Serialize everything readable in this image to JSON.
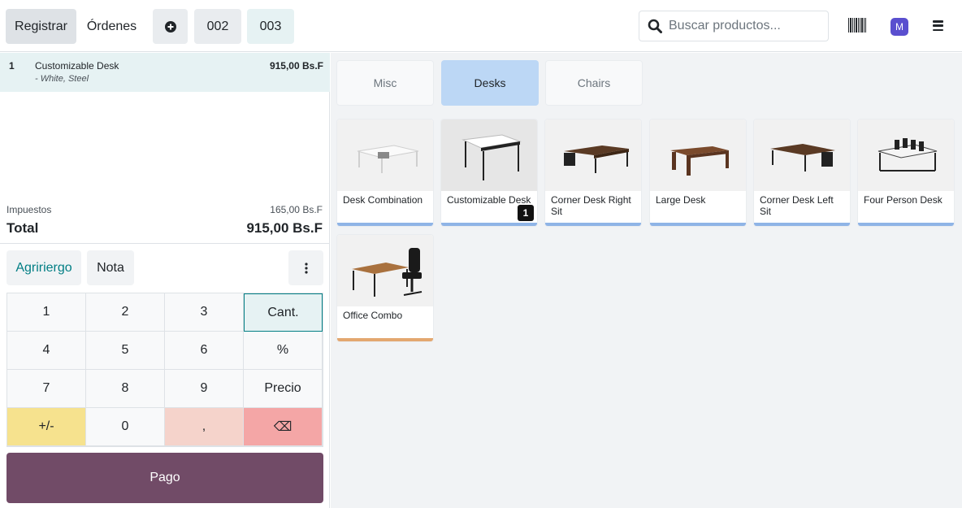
{
  "topbar": {
    "register_label": "Registrar",
    "orders_label": "Órdenes",
    "order_tabs": [
      "002",
      "003"
    ],
    "search_placeholder": "Buscar productos...",
    "avatar_letter": "M"
  },
  "order": {
    "line": {
      "qty": "1",
      "name": "Customizable Desk",
      "attributes": "- White, Steel",
      "price": "915,00 Bs.F"
    },
    "taxes_label": "Impuestos",
    "taxes_value": "165,00 Bs.F",
    "total_label": "Total",
    "total_value": "915,00 Bs.F"
  },
  "actions": {
    "customer_label": "Agririergo",
    "note_label": "Nota",
    "more_icon": "vertical-dots-icon"
  },
  "numpad": {
    "keys": [
      "1",
      "2",
      "3",
      "Cant.",
      "4",
      "5",
      "6",
      "%",
      "7",
      "8",
      "9",
      "Precio",
      "+/-",
      "0",
      ",",
      "⌫"
    ]
  },
  "pay_label": "Pago",
  "categories": [
    "Misc",
    "Desks",
    "Chairs"
  ],
  "products": [
    {
      "name": "Desk Combination",
      "qty": ""
    },
    {
      "name": "Customizable Desk",
      "qty": "1"
    },
    {
      "name": "Corner Desk Right Sit",
      "qty": ""
    },
    {
      "name": "Large Desk",
      "qty": ""
    },
    {
      "name": "Corner Desk Left Sit",
      "qty": ""
    },
    {
      "name": "Four Person Desk",
      "qty": ""
    },
    {
      "name": "Office Combo",
      "qty": ""
    }
  ],
  "colors": {
    "accent": "#714b67",
    "selected_category": "#bcd7f5",
    "selected_line": "#e6f2f3",
    "desk_stripe": "#8fb4e6",
    "combo_stripe": "#e3a76f",
    "sign_key": "#f6e28e",
    "comma_key": "#f5d3cb",
    "backspace_key": "#f4a6a6"
  }
}
